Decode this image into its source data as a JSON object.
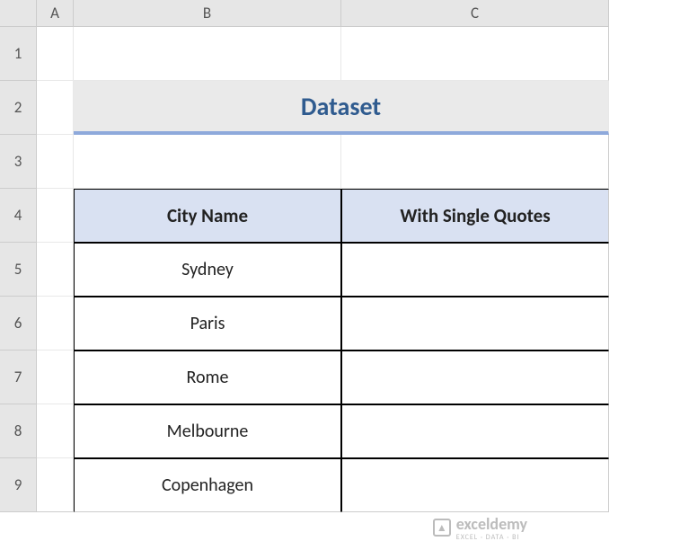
{
  "columns": [
    "A",
    "B",
    "C"
  ],
  "rows": [
    "1",
    "2",
    "3",
    "4",
    "5",
    "6",
    "7",
    "8",
    "9"
  ],
  "title": "Dataset",
  "headers": {
    "b4": "City Name",
    "c4": "With Single Quotes"
  },
  "data": {
    "b5": "Sydney",
    "b6": "Paris",
    "b7": "Rome",
    "b8": "Melbourne",
    "b9": "Copenhagen",
    "c5": "",
    "c6": "",
    "c7": "",
    "c8": "",
    "c9": ""
  },
  "watermark": {
    "main": "exceldemy",
    "sub": "EXCEL · DATA · BI"
  }
}
